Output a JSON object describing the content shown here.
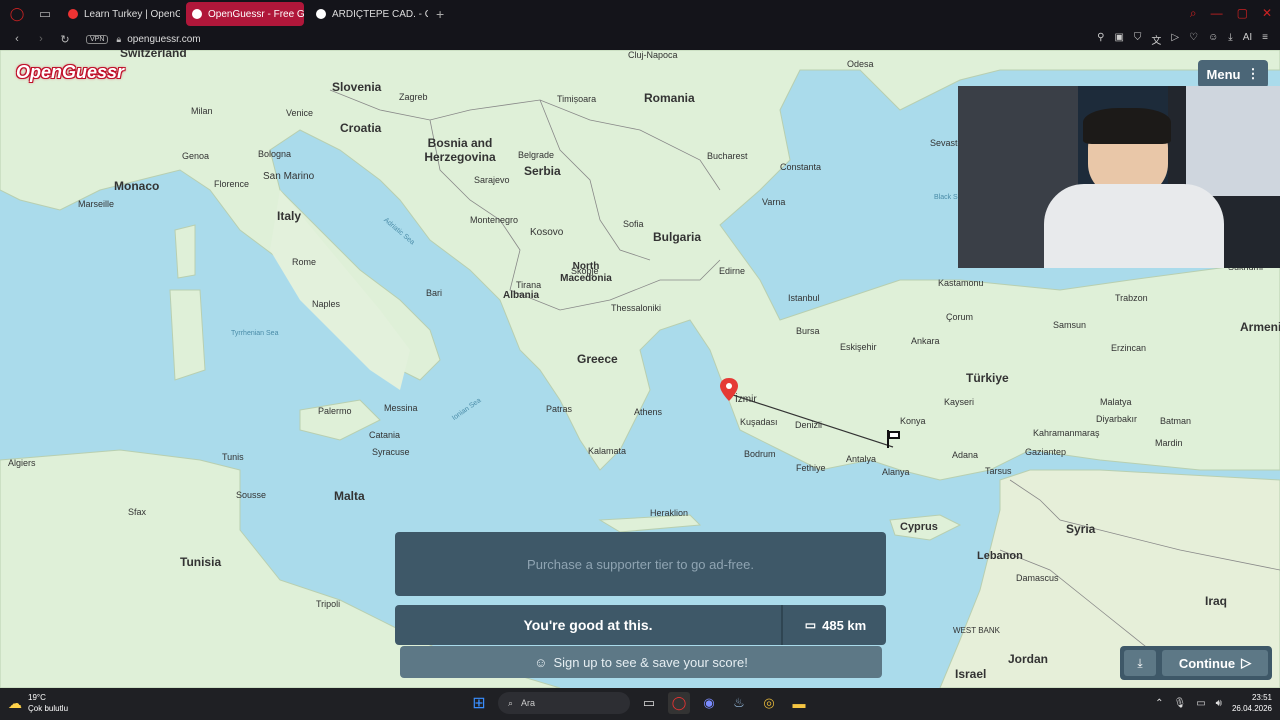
{
  "browser": {
    "tabs": [
      {
        "label": "Learn Turkey | OpenGuess",
        "active": false
      },
      {
        "label": "OpenGuessr - Free Ge",
        "active": true
      },
      {
        "label": "ARDIÇTEPE CAD. - Google",
        "active": false
      }
    ],
    "vpn_label": "VPN",
    "url": "openguessr.com",
    "accent": "#b0173a"
  },
  "game": {
    "logo": "OpenGuessr",
    "menu_label": "Menu",
    "ad_text": "Purchase a supporter tier to go ad-free.",
    "result_text": "You're good at this.",
    "distance": "485 km",
    "signup_text": "Sign up to see & save your score!",
    "continue_label": "Continue"
  },
  "map": {
    "countries": [
      "Switzerland",
      "Slovenia",
      "Croatia",
      "Bosnia and Herzegovina",
      "Serbia",
      "Romania",
      "Monaco",
      "San Marino",
      "Italy",
      "Montenegro",
      "Kosovo",
      "Bulgaria",
      "North Macedonia",
      "Albania",
      "Greece",
      "Türkiye",
      "Armenia",
      "Tunisia",
      "Malta",
      "Syria",
      "Cyprus",
      "Lebanon",
      "Iraq",
      "Jordan",
      "Israel",
      "WEST BANK"
    ],
    "cities": [
      "Milan",
      "Venice",
      "Zagreb",
      "Timișoara",
      "Cluj-Napoca",
      "Odesa",
      "Genoa",
      "Bologna",
      "Sarajevo",
      "Belgrade",
      "Bucharest",
      "Constanta",
      "Sevastopol",
      "Marseille",
      "Florence",
      "Varna",
      "Sofia",
      "Rome",
      "Skopje",
      "Edirne",
      "Tirana",
      "Bari",
      "Thessaloniki",
      "Istanbul",
      "Kastamonu",
      "Trabzon",
      "Naples",
      "Bursa",
      "Eskişehir",
      "Ankara",
      "Erzincan",
      "Çorum",
      "Samsun",
      "Palermo",
      "Messina",
      "Athens",
      "Patras",
      "İzmir",
      "Konya",
      "Kayseri",
      "Malatya",
      "Catania",
      "Kuşadası",
      "Denizli",
      "Adana",
      "Gaziantep",
      "Diyarbakır",
      "Batman",
      "Mardin",
      "Sfax",
      "Tripoli",
      "Damascus",
      "Antalya",
      "Alanya",
      "Fethiye",
      "Bodrum",
      "Kalamata",
      "Heraklion",
      "Algiers",
      "Tunis",
      "Sousse",
      "Syracuse",
      "Sukhumi",
      "Tarsus",
      "Kahramanmaraş"
    ],
    "seas": [
      "Tyrrhenian Sea",
      "Ionian Sea",
      "Adriatic Sea",
      "Black Sea"
    ],
    "water_color": "#aadbeb",
    "land_color": "#dff0d8"
  },
  "taskbar": {
    "temperature": "19°C",
    "weather": "Çok bulutlu",
    "search_placeholder": "Ara",
    "time": "23:51",
    "date": "26.04.2026"
  }
}
